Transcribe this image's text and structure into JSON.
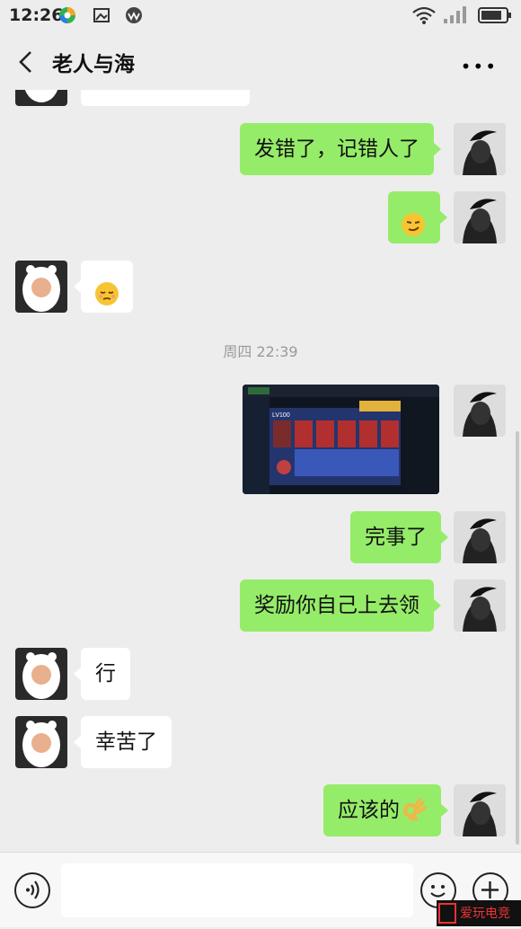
{
  "status_bar": {
    "time": "12:26"
  },
  "header": {
    "title": "老人与海"
  },
  "messages": [
    {
      "from": "me",
      "text": "发错了，记错人了"
    },
    {
      "from": "me",
      "emoji": "smirk-emoji"
    },
    {
      "from": "other",
      "emoji": "relieved-emoji"
    },
    {
      "timestamp": "周四 22:39"
    },
    {
      "from": "me",
      "image": "game-screenshot",
      "image_text": "LV100"
    },
    {
      "from": "me",
      "text": "完事了"
    },
    {
      "from": "me",
      "text": "奖励你自己上去领"
    },
    {
      "from": "other",
      "text": "行"
    },
    {
      "from": "other",
      "text": "幸苦了"
    },
    {
      "from": "me",
      "text": "应该的",
      "emoji": "ok-hand-emoji"
    }
  ],
  "input_bar": {
    "voice": "voice-icon",
    "emoji": "emoji-icon",
    "more": "plus-icon"
  },
  "watermark": {
    "text": "爱玩电竞"
  },
  "colors": {
    "outgoing_bubble": "#95ec69",
    "incoming_bubble": "#ffffff",
    "background": "#ededed"
  }
}
